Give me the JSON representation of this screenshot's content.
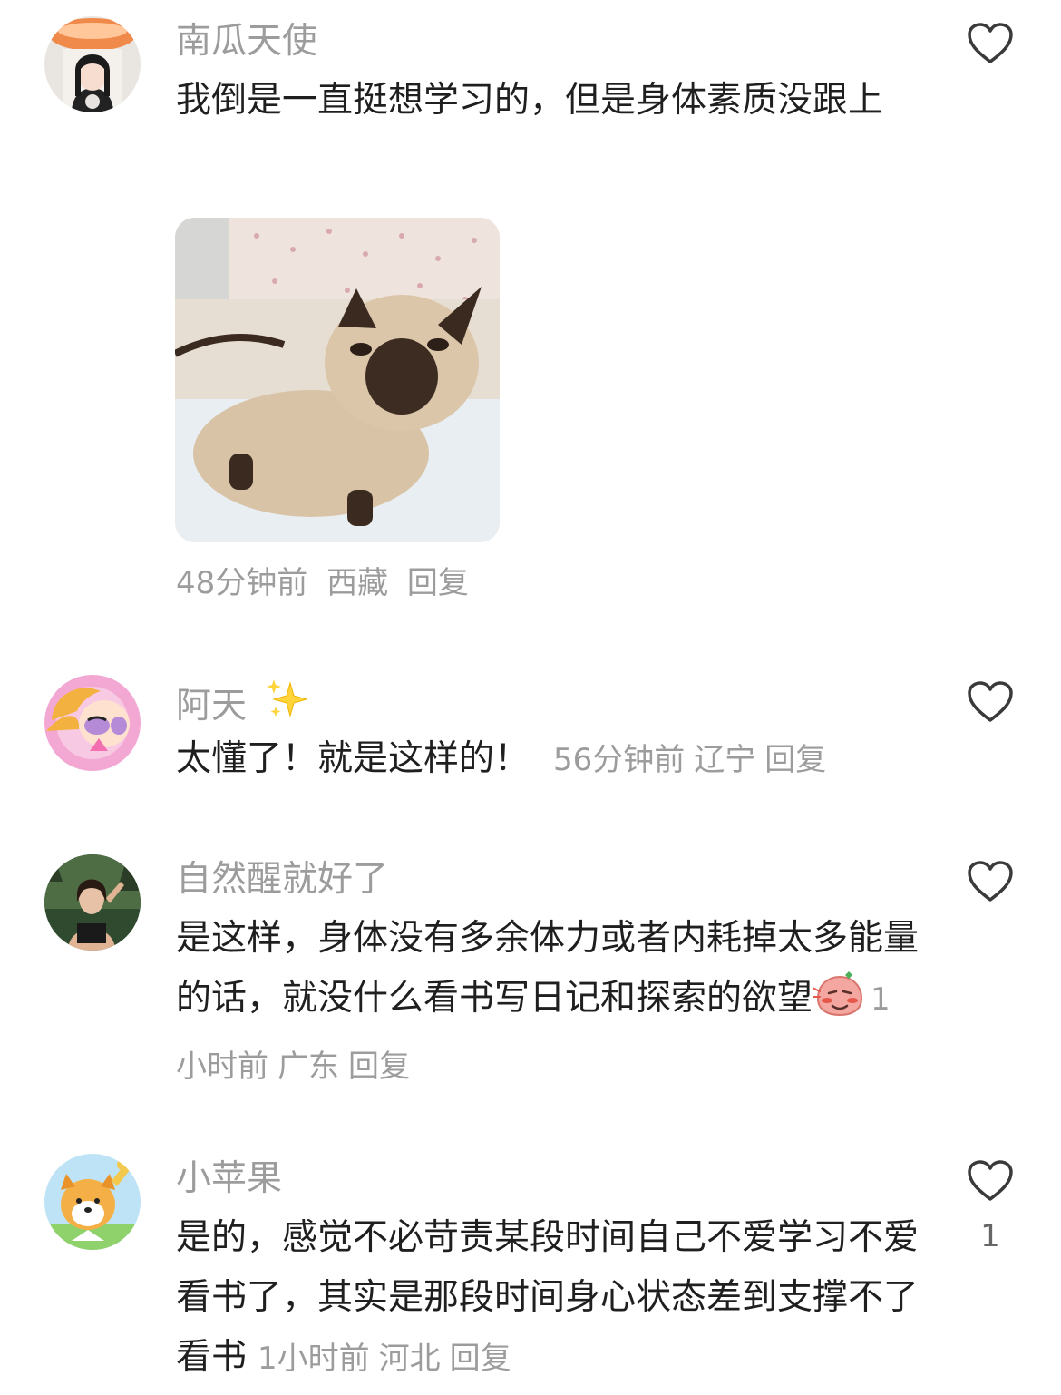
{
  "comments": [
    {
      "username": "南瓜天使",
      "text": "我倒是一直挺想学习的，但是身体素质没跟上",
      "time": "48分钟前",
      "location": "西藏",
      "reply": "回复",
      "like_count": ""
    },
    {
      "username": "阿天",
      "username_emoji": "sparkles-icon",
      "text": "太懂了！就是这样的！",
      "time": "56分钟前",
      "location": "辽宁",
      "reply": "回复",
      "like_count": ""
    },
    {
      "username": "自然醒就好了",
      "text": "是这样，身体没有多余体力或者内耗掉太多能量的话，就没什么看书写日记和探索的欲望",
      "text_emoji": "blushing-face-sticker",
      "time": "1小时前",
      "location": "广东",
      "reply": "回复",
      "like_count": ""
    },
    {
      "username": "小苹果",
      "text": "是的，感觉不必苛责某段时间自己不爱学习不爱看书了，其实是那段时间身心状态差到支撑不了看书",
      "time": "1小时前",
      "location": "河北",
      "reply": "回复",
      "like_count": "1"
    }
  ],
  "colors": {
    "text": "#1f1f1f",
    "secondary": "#9c9c9c",
    "like_outline": "#3a3a3a"
  }
}
